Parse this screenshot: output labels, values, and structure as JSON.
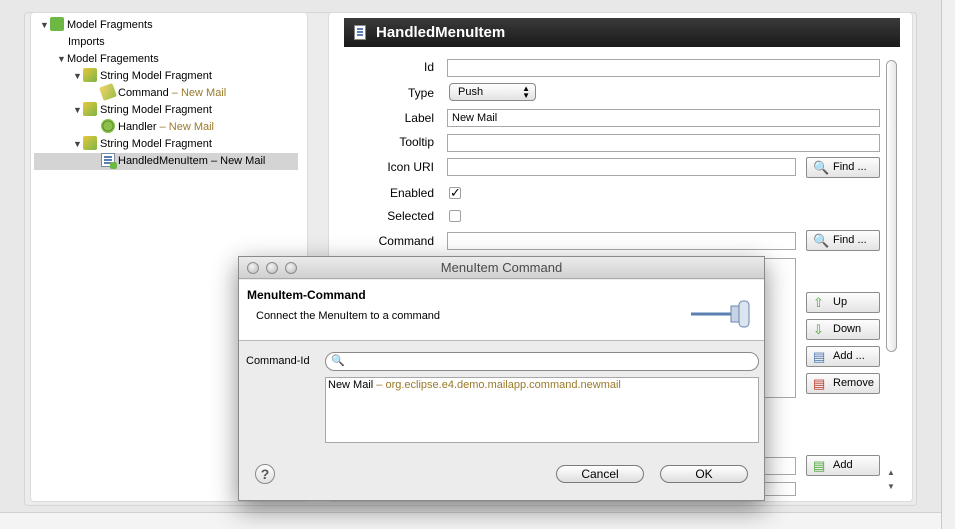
{
  "tree": {
    "root": "Model Fragments",
    "imports": "Imports",
    "fragments_parent": "Model Fragements",
    "items": [
      {
        "fragment": "String Model Fragment",
        "child": "Command",
        "child_sub": "New Mail"
      },
      {
        "fragment": "String Model Fragment",
        "child": "Handler",
        "child_sub": "New Mail"
      },
      {
        "fragment": "String Model Fragment",
        "child": "HandledMenuItem",
        "child_sub": "New Mail"
      }
    ],
    "separator": " – "
  },
  "editor": {
    "title": "HandledMenuItem",
    "fields": {
      "id_label": "Id",
      "id_value": "",
      "type_label": "Type",
      "type_value": "Push",
      "label_label": "Label",
      "label_value": "New Mail",
      "tooltip_label": "Tooltip",
      "tooltip_value": "",
      "icon_label": "Icon URI",
      "icon_value": "",
      "enabled_label": "Enabled",
      "enabled_checked": true,
      "selected_label": "Selected",
      "selected_checked": false,
      "command_label": "Command",
      "command_value": ""
    },
    "buttons": {
      "find": "Find ...",
      "up": "Up",
      "down": "Down",
      "add_dots": "Add ...",
      "remove": "Remove",
      "add": "Add"
    }
  },
  "dialog": {
    "window_title": "MenuItem Command",
    "heading": "MenuItem-Command",
    "description": "Connect the MenuItem to a command",
    "command_id_label": "Command-Id",
    "search_value": "",
    "results": [
      {
        "name": "New Mail",
        "id": "org.eclipse.e4.demo.mailapp.command.newmail"
      }
    ],
    "result_sep": " – ",
    "cancel": "Cancel",
    "ok": "OK",
    "help_glyph": "?"
  }
}
